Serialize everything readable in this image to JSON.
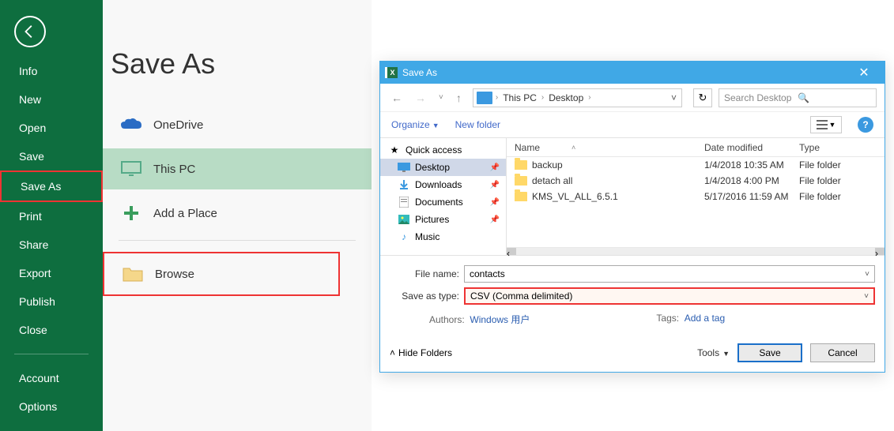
{
  "sidebar": {
    "items": [
      "Info",
      "New",
      "Open",
      "Save",
      "Save As",
      "Print",
      "Share",
      "Export",
      "Publish",
      "Close"
    ],
    "selected": "Save As",
    "footer": [
      "Account",
      "Options"
    ]
  },
  "main": {
    "title": "Save As",
    "locations": {
      "onedrive": "OneDrive",
      "thispc": "This PC",
      "addplace": "Add a Place",
      "browse": "Browse"
    }
  },
  "dialog": {
    "title": "Save As",
    "breadcrumb": [
      "This PC",
      "Desktop"
    ],
    "searchPlaceholder": "Search Desktop",
    "toolbar": {
      "organize": "Organize",
      "newfolder": "New folder"
    },
    "tree": {
      "quick": "Quick access",
      "items": [
        "Desktop",
        "Downloads",
        "Documents",
        "Pictures",
        "Music"
      ]
    },
    "columns": {
      "name": "Name",
      "date": "Date modified",
      "type": "Type"
    },
    "files": [
      {
        "name": "backup",
        "date": "1/4/2018 10:35 AM",
        "type": "File folder"
      },
      {
        "name": "detach all",
        "date": "1/4/2018 4:00 PM",
        "type": "File folder"
      },
      {
        "name": "KMS_VL_ALL_6.5.1",
        "date": "5/17/2016 11:59 AM",
        "type": "File folder"
      }
    ],
    "fields": {
      "filenameLabel": "File name:",
      "filename": "contacts",
      "typeLabel": "Save as type:",
      "type": "CSV (Comma delimited)",
      "authorsLabel": "Authors:",
      "authors": "Windows 用户",
      "tagsLabel": "Tags:",
      "tags": "Add a tag"
    },
    "footer": {
      "hide": "Hide Folders",
      "tools": "Tools",
      "save": "Save",
      "cancel": "Cancel"
    }
  }
}
